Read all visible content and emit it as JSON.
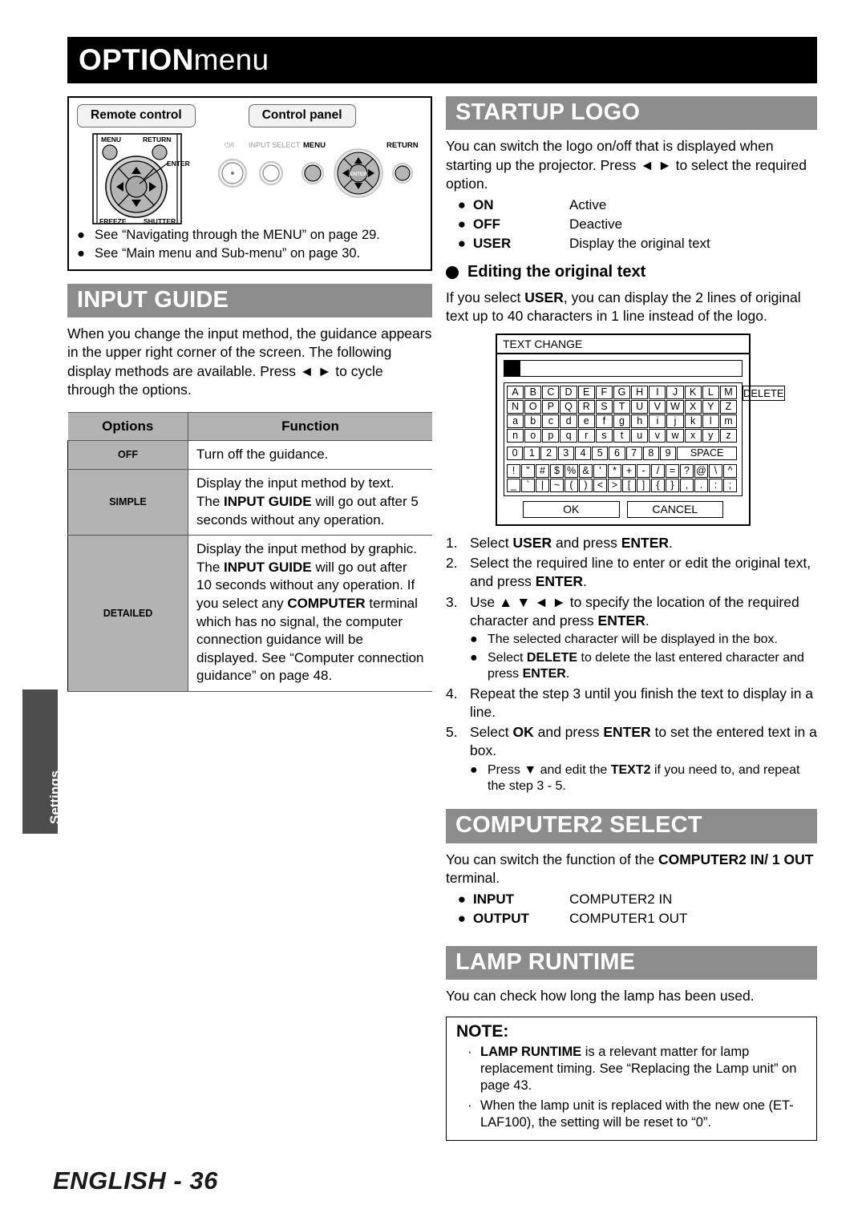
{
  "page": {
    "title_strong": "OPTION",
    "title_thin": " menu",
    "side_tab": "Settings",
    "footer_language": "ENGLISH - ",
    "footer_page": "36"
  },
  "remote_box": {
    "tab_remote": "Remote control",
    "tab_panel": "Control panel",
    "remote_labels": {
      "menu": "MENU",
      "return": "RETURN",
      "enter": "ENTER",
      "freeze": "FREEZE",
      "shutter": "SHUTTER"
    },
    "panel_labels": {
      "power": "⏻/I",
      "input_select": "INPUT SELECT",
      "menu": "MENU",
      "enter": "ENTER",
      "return": "RETURN"
    },
    "notes": [
      "See “Navigating through the MENU” on page 29.",
      "See “Main menu and Sub-menu” on page 30."
    ],
    "bullet": "●"
  },
  "input_guide": {
    "heading": "INPUT GUIDE",
    "intro_1": "When you change the input method, the guidance appears in the upper right corner of the screen. The following display methods are available. Press ",
    "intro_arrows": "◄ ►",
    "intro_2": " to cycle through the options.",
    "table": {
      "headers": [
        "Options",
        "Function"
      ],
      "rows": [
        {
          "option": "OFF",
          "function_parts": [
            {
              "text": "Turn off the guidance.",
              "bold": false
            }
          ]
        },
        {
          "option": "SIMPLE",
          "function_parts": [
            {
              "text": "Display the input method by text.\nThe ",
              "bold": false
            },
            {
              "text": "INPUT GUIDE",
              "bold": true
            },
            {
              "text": " will go out after 5 seconds without any operation.",
              "bold": false
            }
          ]
        },
        {
          "option": "DETAILED",
          "function_parts": [
            {
              "text": "Display the input method by graphic.\nThe ",
              "bold": false
            },
            {
              "text": "INPUT GUIDE",
              "bold": true
            },
            {
              "text": " will go out after 10 seconds without any operation. If you select any ",
              "bold": false
            },
            {
              "text": "COMPUTER",
              "bold": true
            },
            {
              "text": " terminal which has no signal, the computer connection guidance will be displayed. See “Computer connection guidance” on page 48.",
              "bold": false
            }
          ]
        }
      ]
    }
  },
  "startup_logo": {
    "heading": "STARTUP LOGO",
    "intro_1": "You can switch the logo on/off that is displayed when starting up the projector. Press ",
    "intro_arrows": "◄ ►",
    "intro_2": " to select the required option.",
    "options": [
      {
        "name": "ON",
        "desc": "Active"
      },
      {
        "name": "OFF",
        "desc": "Deactive"
      },
      {
        "name": "USER",
        "desc": "Display the original text"
      }
    ],
    "sub_heading": "Editing the original text",
    "sub_intro_1": "If you select ",
    "sub_intro_user": "USER",
    "sub_intro_2": ", you can display the 2 lines of original text up to 40 characters in 1 line instead of the logo.",
    "dialog": {
      "title": "TEXT CHANGE",
      "delete_label": "DELETE",
      "rows_alpha": [
        [
          "A",
          "B",
          "C",
          "D",
          "E",
          "F",
          "G",
          "H",
          "I",
          "J",
          "K",
          "L",
          "M"
        ],
        [
          "N",
          "O",
          "P",
          "Q",
          "R",
          "S",
          "T",
          "U",
          "V",
          "W",
          "X",
          "Y",
          "Z"
        ],
        [
          "a",
          "b",
          "c",
          "d",
          "e",
          "f",
          "g",
          "h",
          "i",
          "j",
          "k",
          "l",
          "m"
        ],
        [
          "n",
          "o",
          "p",
          "q",
          "r",
          "s",
          "t",
          "u",
          "v",
          "w",
          "x",
          "y",
          "z"
        ]
      ],
      "row_digits": [
        "0",
        "1",
        "2",
        "3",
        "4",
        "5",
        "6",
        "7",
        "8",
        "9"
      ],
      "space_label": "SPACE",
      "rows_symbols": [
        [
          "!",
          "\"",
          "#",
          "$",
          "%",
          "&",
          "'",
          "*",
          "+",
          "-",
          "/",
          "=",
          "?",
          "@",
          "\\",
          "^"
        ],
        [
          "_",
          "`",
          "|",
          "~",
          "(",
          ")",
          "<",
          ">",
          "[",
          "]",
          "{",
          "}",
          ",",
          ".",
          ":",
          ";"
        ]
      ],
      "ok_label": "OK",
      "cancel_label": "CANCEL"
    },
    "steps": [
      {
        "num": "1.",
        "parts": [
          {
            "text": "Select ",
            "bold": false
          },
          {
            "text": "USER",
            "bold": true
          },
          {
            "text": " and press ",
            "bold": false
          },
          {
            "text": "ENTER",
            "bold": true
          },
          {
            "text": ".",
            "bold": false
          }
        ],
        "sub": []
      },
      {
        "num": "2.",
        "parts": [
          {
            "text": "Select the required line to enter or edit the original text, and press ",
            "bold": false
          },
          {
            "text": "ENTER",
            "bold": true
          },
          {
            "text": ".",
            "bold": false
          }
        ],
        "sub": []
      },
      {
        "num": "3.",
        "parts": [
          {
            "text": "Use ",
            "bold": false
          },
          {
            "text": "▲ ▼ ◄ ►",
            "bold": false
          },
          {
            "text": " to specify the location of the required character and press ",
            "bold": false
          },
          {
            "text": "ENTER",
            "bold": true
          },
          {
            "text": ".",
            "bold": false
          }
        ],
        "sub": [
          [
            {
              "text": "The selected character will be displayed in the box.",
              "bold": false
            }
          ],
          [
            {
              "text": "Select ",
              "bold": false
            },
            {
              "text": "DELETE",
              "bold": true
            },
            {
              "text": " to delete the last entered character and press ",
              "bold": false
            },
            {
              "text": "ENTER",
              "bold": true
            },
            {
              "text": ".",
              "bold": false
            }
          ]
        ]
      },
      {
        "num": "4.",
        "parts": [
          {
            "text": "Repeat the step 3 until you finish the text to display in a line.",
            "bold": false
          }
        ],
        "sub": []
      },
      {
        "num": "5.",
        "parts": [
          {
            "text": "Select ",
            "bold": false
          },
          {
            "text": "OK",
            "bold": true
          },
          {
            "text": " and press ",
            "bold": false
          },
          {
            "text": "ENTER",
            "bold": true
          },
          {
            "text": " to set the entered text in a box.",
            "bold": false
          }
        ],
        "sub": [
          [
            {
              "text": "Press ",
              "bold": false
            },
            {
              "text": "▼",
              "bold": false
            },
            {
              "text": " and edit the ",
              "bold": false
            },
            {
              "text": "TEXT2",
              "bold": true
            },
            {
              "text": " if you need to, and repeat the step 3 - 5.",
              "bold": false
            }
          ]
        ]
      }
    ]
  },
  "computer2_select": {
    "heading": "COMPUTER2 SELECT",
    "intro_parts": [
      {
        "text": "You can switch the function of the ",
        "bold": false
      },
      {
        "text": "COMPUTER2 IN/ 1 OUT",
        "bold": true
      },
      {
        "text": " terminal.",
        "bold": false
      }
    ],
    "options": [
      {
        "name": "INPUT",
        "desc": "COMPUTER2 IN"
      },
      {
        "name": "OUTPUT",
        "desc": "COMPUTER1 OUT"
      }
    ]
  },
  "lamp_runtime": {
    "heading": "LAMP RUNTIME",
    "intro": "You can check how long the lamp has been used.",
    "note": {
      "heading": "NOTE:",
      "items": [
        [
          {
            "text": "LAMP RUNTIME",
            "bold": true
          },
          {
            "text": " is a relevant matter for lamp replacement timing. See “Replacing the Lamp unit” on page 43.",
            "bold": false
          }
        ],
        [
          {
            "text": "When the lamp unit is replaced with the new one (ET-LAF100), the setting will be reset to “0”.",
            "bold": false
          }
        ]
      ],
      "bullet": "·"
    }
  },
  "colors": {
    "header_bar": "#8c8c8c",
    "table_key": "#b3b3b3",
    "side_tab": "#4d4d4d",
    "title_bar": "#000000"
  }
}
